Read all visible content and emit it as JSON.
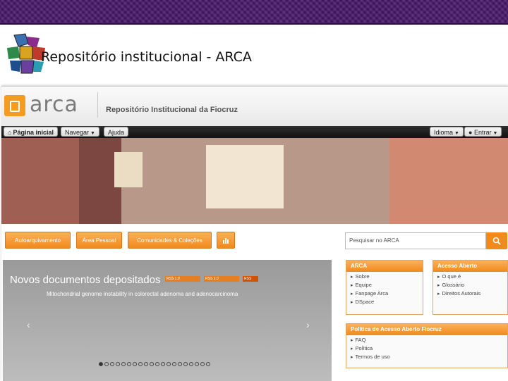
{
  "slide": {
    "title": "Repositório institucional - ARCA"
  },
  "header": {
    "logo_text": "arca",
    "repository_name": "Repositório Institucional da Fiocruz"
  },
  "navbar": {
    "home": "Página inicial",
    "browse": "Navegar",
    "help": "Ajuda",
    "language": "Idioma",
    "login": "Entrar"
  },
  "actions": {
    "self_archiving": "Autoarquivamento",
    "personal_area": "Área Pessoal",
    "communities": "Comunidades & Coleções",
    "search_placeholder": "Pesquisar no ARCA"
  },
  "slider": {
    "title": "Novos documentos depositados",
    "feeds": [
      "RSS 1.0",
      "RSS 2.0",
      "RSS"
    ],
    "item": "Mitochondrial genome instability in colorectal adenoma and adenocarcinoma",
    "dot_count": 20,
    "active_dot": 0
  },
  "panels": {
    "arca": {
      "title": "ARCA",
      "links": [
        "Sobre",
        "Equipe",
        "Fanpage Arca",
        "DSpace"
      ]
    },
    "open_access": {
      "title": "Acesso Aberto",
      "links": [
        "O que é",
        "Glossário",
        "Direitos Autorais"
      ]
    },
    "policy": {
      "title": "Política de Acesso Aberto Fiocruz",
      "links": [
        "FAQ",
        "Política",
        "Termos de uso"
      ]
    }
  },
  "colors": {
    "accent": "#f08a1c",
    "navbar": "#1f1f1f",
    "band": "#4a1a6e"
  }
}
